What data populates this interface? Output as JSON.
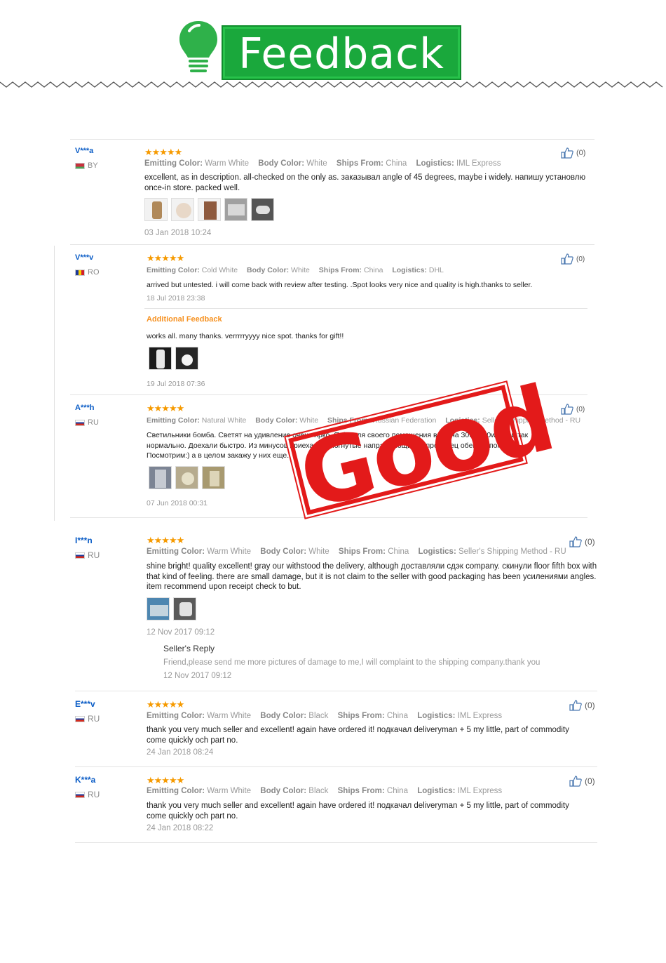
{
  "header": {
    "title": "Feedback"
  },
  "reviews": [
    {
      "user": "V***a",
      "country": "BY",
      "stars": "★★★★★",
      "emit_label": "Emitting Color:",
      "emit": "Warm White",
      "body_label": "Body Color:",
      "body": "White",
      "ships_label": "Ships From:",
      "ships": "China",
      "log_label": "Logistics:",
      "log": "IML Express",
      "text": "excellent, as in description. all-checked on the only as. заказывал angle of 45 degrees, maybe i widely. напишу установлю once-in store. packed well.",
      "date": "03 Jan 2018 10:24",
      "likes": "(0)"
    },
    {
      "user": "V***v",
      "country": "RO",
      "stars": "★★★★★",
      "emit_label": "Emitting Color:",
      "emit": "Cold White",
      "body_label": "Body Color:",
      "body": "White",
      "ships_label": "Ships From:",
      "ships": "China",
      "log_label": "Logistics:",
      "log": "DHL",
      "text": "arrived but untested. i will come back with review after testing. .Spot looks very nice and quality is high.thanks to seller.",
      "date": "18 Jul 2018 23:38",
      "likes": "(0)",
      "additional_label": "Additional Feedback",
      "additional_text": "works all. many thanks. verrrrryyyy nice spot. thanks for gift!!",
      "additional_date": "19 Jul 2018 07:36"
    },
    {
      "user": "A***h",
      "country": "RU",
      "stars": "★★★★★",
      "emit_label": "Emitting Color:",
      "emit": "Natural White",
      "body_label": "Body Color:",
      "body": "White",
      "ships_label": "Ships From:",
      "ships": "Russian Federation",
      "log_label": "Logistics:",
      "log": "Seller's Shipping Method - RU",
      "text": "Светильники бомба. Светят на удивление очень ярко. Я бы для своего помещения взял на 30w а 20w. Но и так нормально. Доехали быстро. Из минусов приехало 2 погнутые направляющие.... продавец обещал поменять. Посмотрим:) а в целом закажу у них еще.",
      "date": "07 Jun 2018 00:31",
      "likes": "(0)"
    },
    {
      "user": "I***n",
      "country": "RU",
      "stars": "★★★★★",
      "emit_label": "Emitting Color:",
      "emit": "Warm White",
      "body_label": "Body Color:",
      "body": "White",
      "ships_label": "Ships From:",
      "ships": "China",
      "log_label": "Logistics:",
      "log": "Seller's Shipping Method - RU",
      "text": "shine bright! quality excellent! gray our withstood the delivery, although доставляли сдэк company. скинули floor fifth box with that kind of feeling. there are small damage, but it is not claim to the seller with good packaging has been усилениями angles. item recommend upon receipt check to but.",
      "date": "12 Nov 2017 09:12",
      "likes": "(0)",
      "reply_label": "Seller's Reply",
      "reply_text": "Friend,please send me more pictures of damage to me,I will complaint to the shipping company.thank you",
      "reply_date": "12 Nov 2017 09:12"
    },
    {
      "user": "E***v",
      "country": "RU",
      "stars": "★★★★★",
      "emit_label": "Emitting Color:",
      "emit": "Warm White",
      "body_label": "Body Color:",
      "body": "Black",
      "ships_label": "Ships From:",
      "ships": "China",
      "log_label": "Logistics:",
      "log": "IML Express",
      "text": "thank you very much seller and excellent! again have ordered it! подкачал deliveryman + 5 my little, part of commodity come quickly och part no.",
      "date": "24 Jan 2018 08:24",
      "likes": "(0)"
    },
    {
      "user": "K***a",
      "country": "RU",
      "stars": "★★★★★",
      "emit_label": "Emitting Color:",
      "emit": "Warm White",
      "body_label": "Body Color:",
      "body": "Black",
      "ships_label": "Ships From:",
      "ships": "China",
      "log_label": "Logistics:",
      "log": "IML Express",
      "text": "thank you very much seller and excellent! again have ordered it! подкачал deliveryman + 5 my little, part of commodity come quickly och part no.",
      "date": "24 Jan 2018 08:22",
      "likes": "(0)"
    }
  ],
  "stamp": {
    "text": "Good"
  },
  "colors": {
    "brand_green": "#1aa83c",
    "star": "#f69a00",
    "stamp_red": "#e31a1a",
    "username_blue": "#0a5cc6",
    "additional_orange": "#f6901e"
  }
}
